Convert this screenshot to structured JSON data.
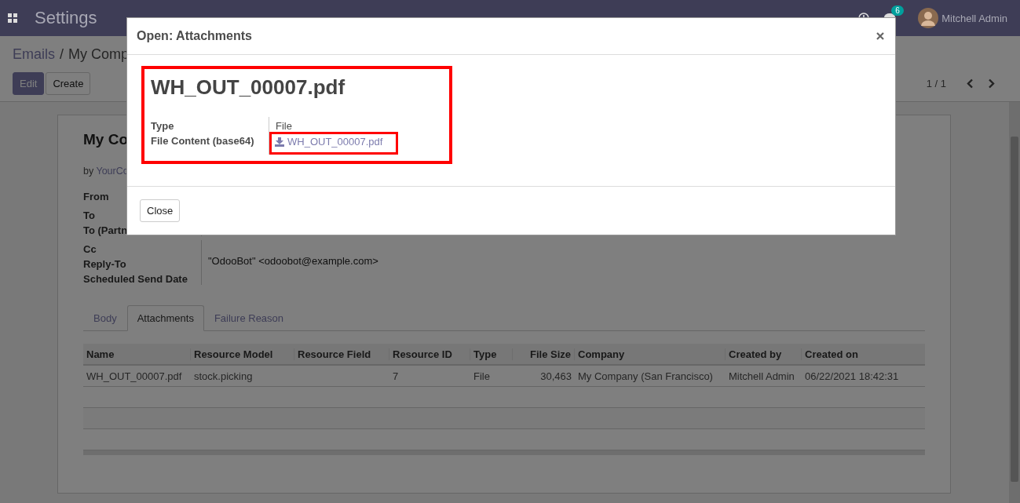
{
  "navbar": {
    "app_title": "Settings",
    "chat_badge": "6",
    "user": "Mitchell Admin"
  },
  "breadcrumb": {
    "items": [
      "Emails",
      "My Comp"
    ],
    "separator": "/"
  },
  "buttons": [
    {
      "label": "Edit",
      "kind": "primary"
    },
    {
      "label": "Create",
      "kind": "secondary"
    }
  ],
  "pager": "1 / 1",
  "record": {
    "title": "My Co",
    "by_prefix": "by",
    "author": "YourCo",
    "fields": [
      {
        "label": "From"
      },
      {
        "label": "To"
      },
      {
        "label": "To (Partn"
      },
      {
        "label": "Cc"
      },
      {
        "label": "Reply-To",
        "value": "\"OdooBot\" <odoobot@example.com>"
      },
      {
        "label": "Scheduled Send Date"
      }
    ]
  },
  "tabs": [
    {
      "label": "Body",
      "selected": false
    },
    {
      "label": "Attachments",
      "selected": true
    },
    {
      "label": "Failure Reason",
      "selected": false
    }
  ],
  "table": {
    "columns": [
      {
        "label": "Name",
        "kind": "text"
      },
      {
        "label": "Resource Model",
        "kind": "text"
      },
      {
        "label": "Resource Field",
        "kind": "text"
      },
      {
        "label": "Resource ID",
        "kind": "text"
      },
      {
        "label": "Type",
        "kind": "text"
      },
      {
        "label": "File Size",
        "kind": "number"
      },
      {
        "label": "Company",
        "kind": "text"
      },
      {
        "label": "Created by",
        "kind": "text"
      },
      {
        "label": "Created on",
        "kind": "text"
      }
    ],
    "rows": [
      {
        "cells": [
          "WH_OUT_00007.pdf",
          "stock.picking",
          "",
          "7",
          "File",
          "30,463",
          "My Company (San Francisco)",
          "Mitchell Admin",
          "06/22/2021 18:42:31"
        ]
      }
    ]
  },
  "dialog": {
    "title": "Open: Attachments",
    "record_name": "WH_OUT_00007.pdf",
    "fields": [
      {
        "label": "Type",
        "value": "File",
        "kind": "text"
      },
      {
        "label": "File Content (base64)",
        "value": "WH_OUT_00007.pdf",
        "kind": "download"
      }
    ],
    "buttons": [
      "Close"
    ]
  }
}
